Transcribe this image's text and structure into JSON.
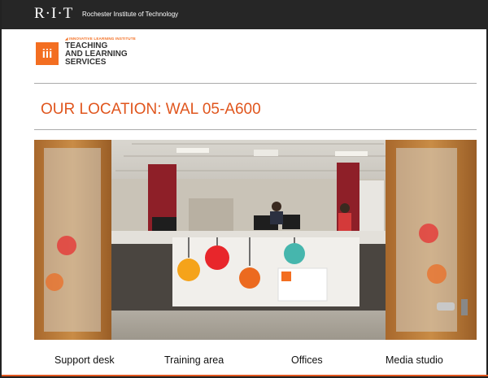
{
  "header": {
    "logo": "R·I·T",
    "institute_name": "Rochester Institute of Technology"
  },
  "brand": {
    "badge_text": "iii",
    "institute_label": "◢ INNOVATIVE LEARNING INSTITUTE",
    "name_line1": "TEACHING",
    "name_line2": "AND LEARNING",
    "name_line3": "SERVICES"
  },
  "slide": {
    "title": "OUR LOCATION: WAL 05-A600"
  },
  "captions": [
    "Support desk",
    "Training area",
    "Offices",
    "Media studio"
  ],
  "colors": {
    "accent": "#e0561e",
    "topbar": "#262626",
    "badge": "#f36e21"
  }
}
